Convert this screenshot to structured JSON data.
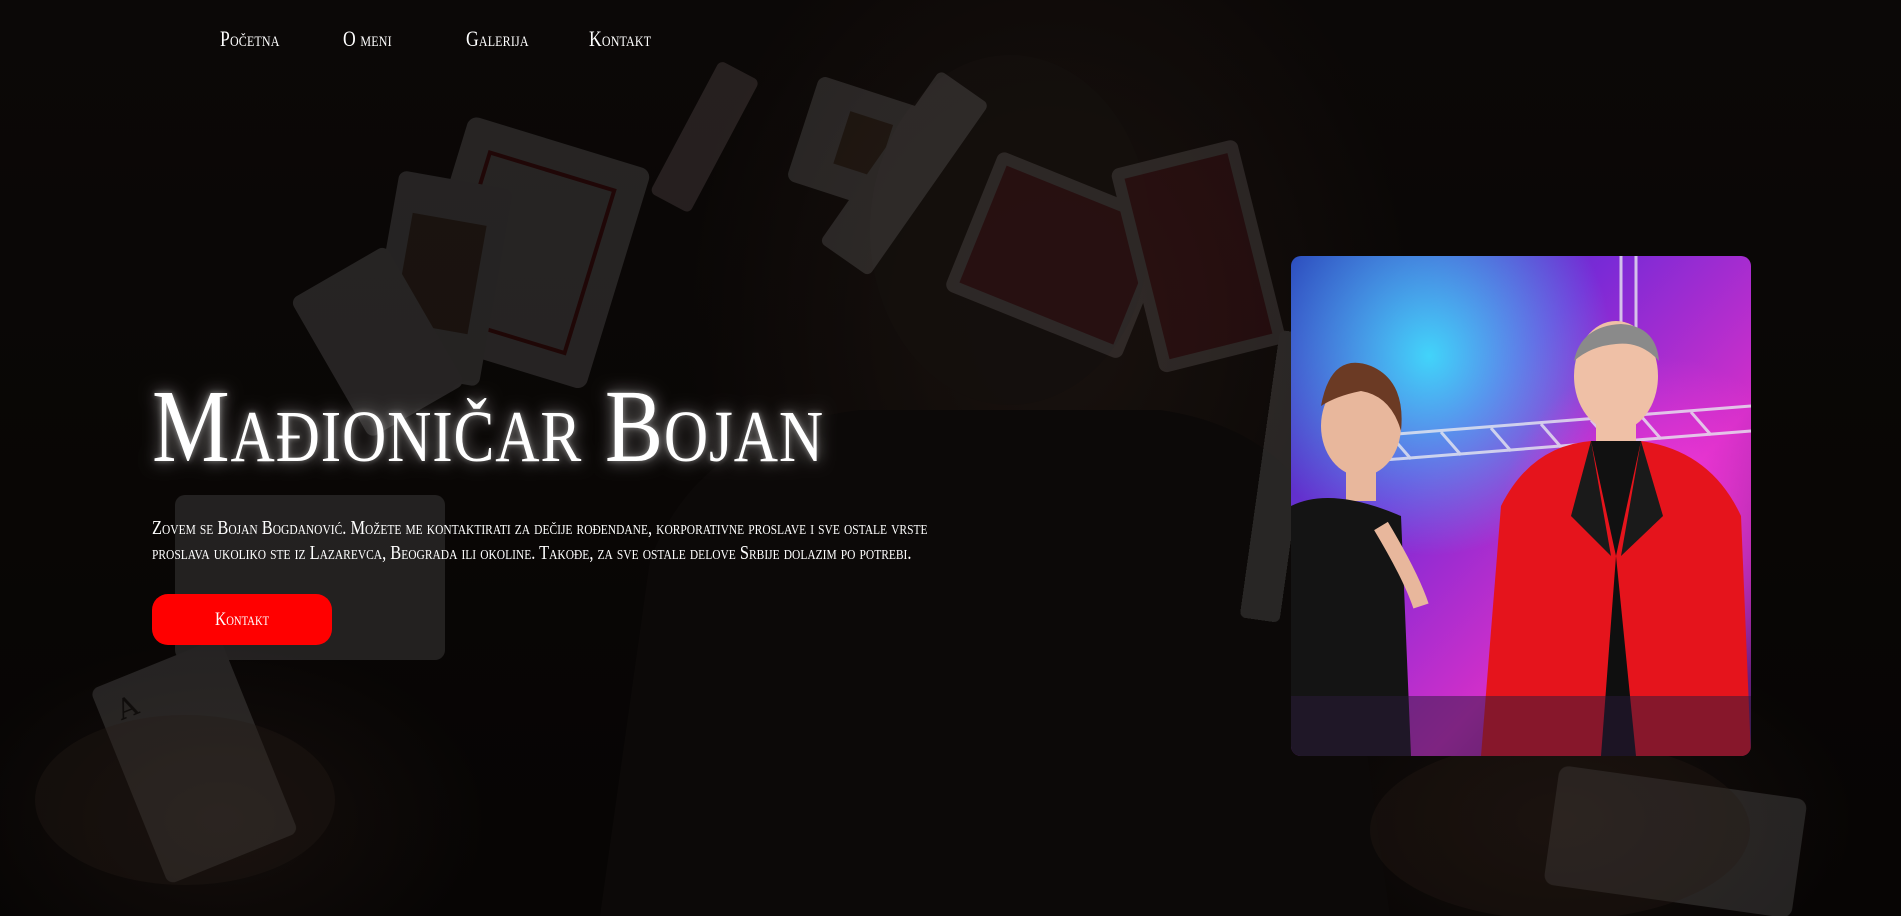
{
  "nav": {
    "items": [
      {
        "label": "Početna"
      },
      {
        "label": "O meni"
      },
      {
        "label": "Galerija"
      },
      {
        "label": "Kontakt"
      }
    ]
  },
  "hero": {
    "title": "Mađioničar Bojan",
    "description": "Zovem se Bojan Bogdanović. Možete me kontaktirati za dečije rođendane, korporativne proslave i sve ostale vrste proslava ukoliko ste iz Lazarevca, Beograda ili okoline. Takođe, za sve ostale delove Srbije dolazim po potrebi.",
    "cta_label": "Kontakt"
  },
  "colors": {
    "accent": "#ff0000",
    "background": "#0d0908",
    "text": "#ffffff"
  },
  "images": {
    "background": "magician-with-flying-cards",
    "photo": "magician-red-jacket-on-stage"
  }
}
